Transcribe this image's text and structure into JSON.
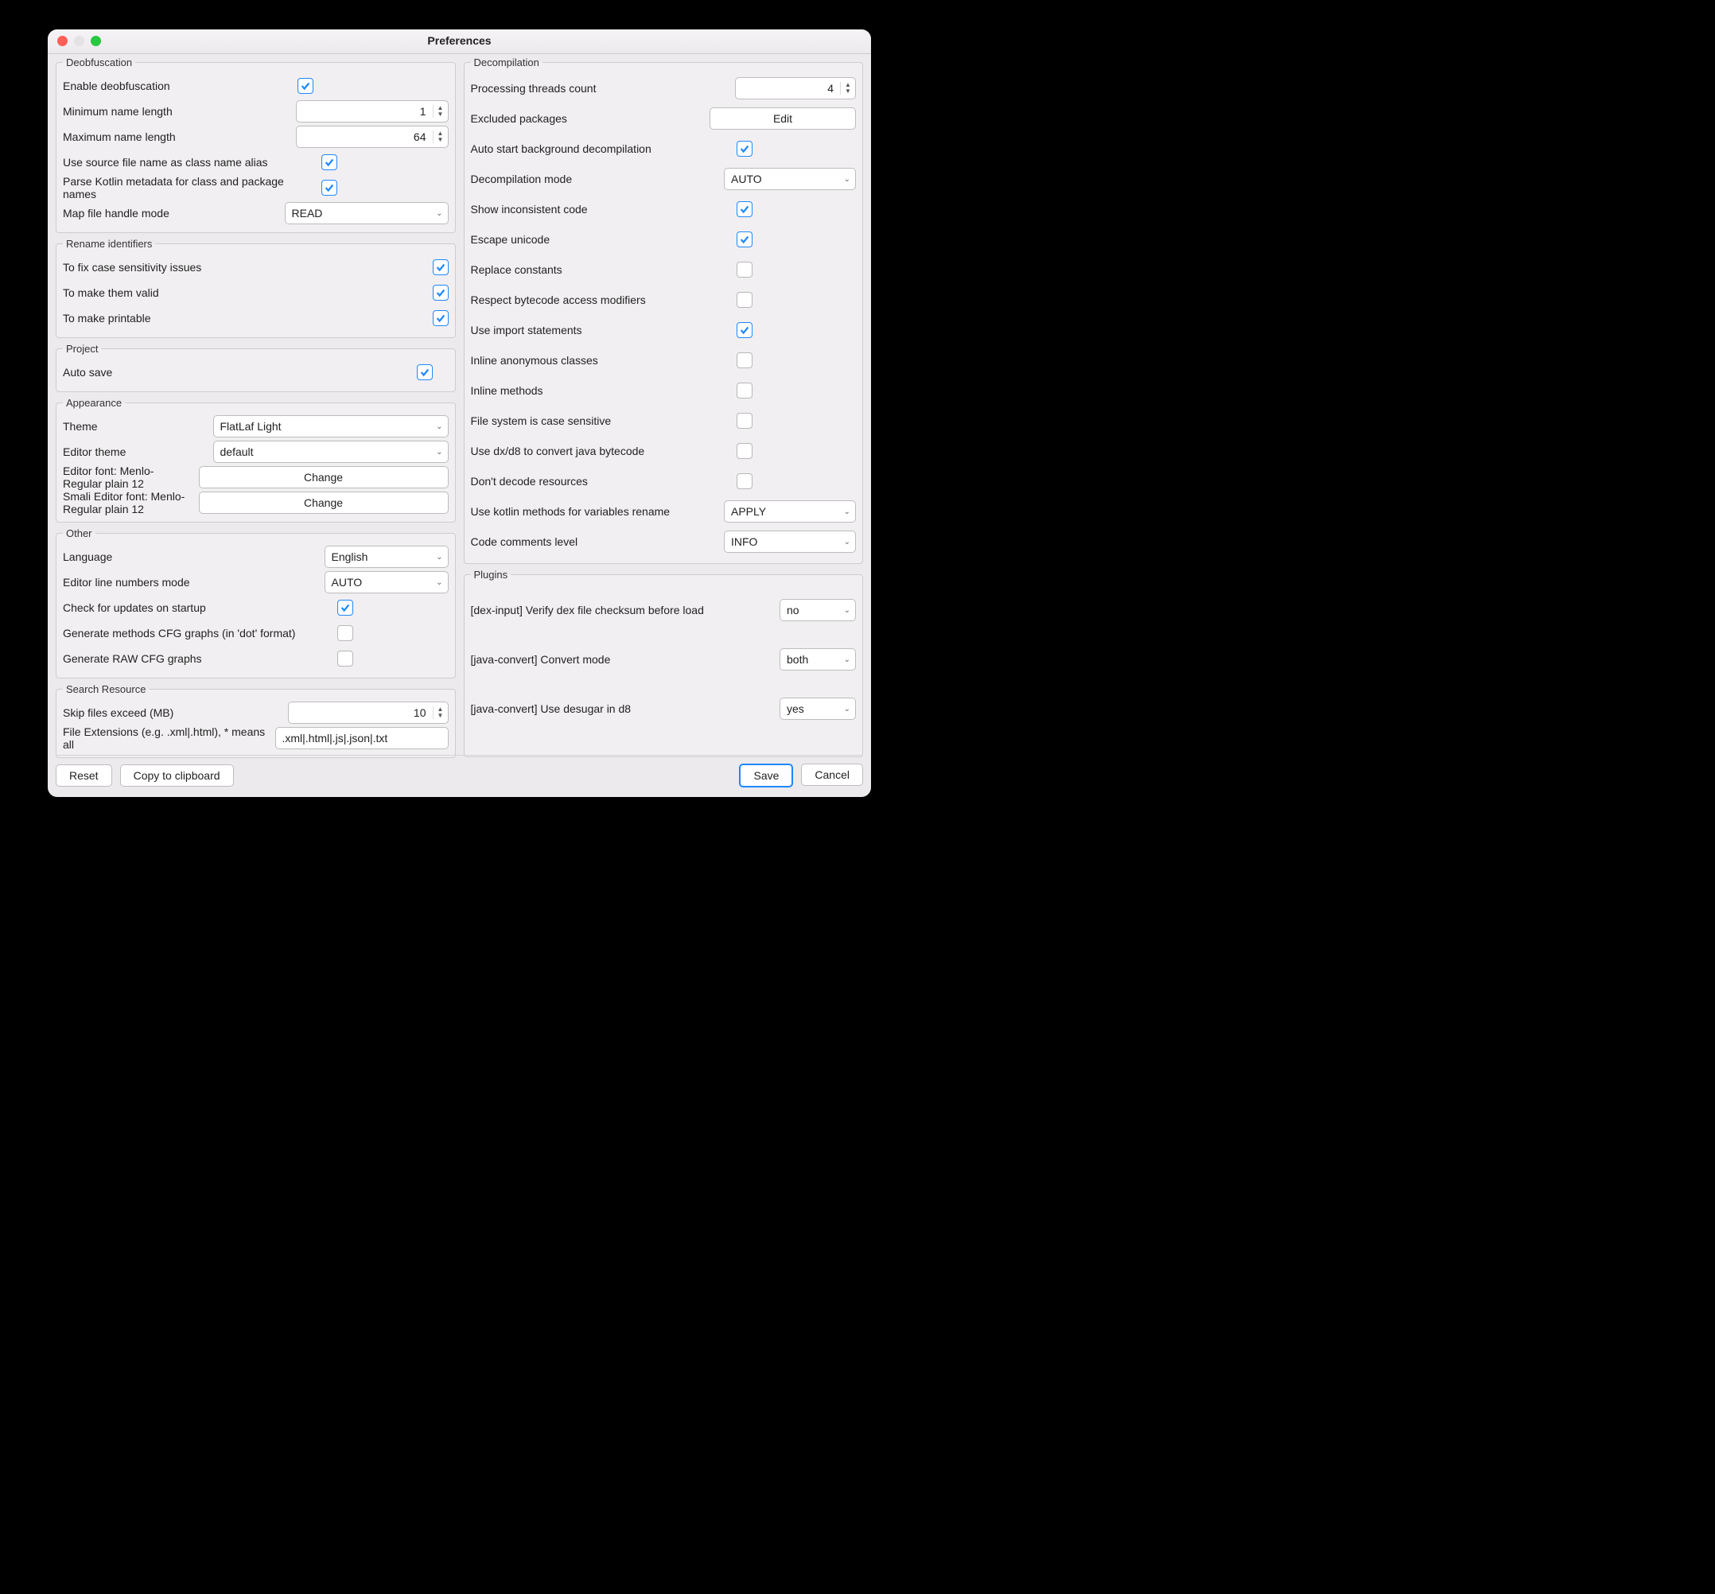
{
  "window_title": "Preferences",
  "left": {
    "deob": {
      "legend": "Deobfuscation",
      "enable_label": "Enable deobfuscation",
      "enable_checked": true,
      "min_len_label": "Minimum name length",
      "min_len_value": "1",
      "max_len_label": "Maximum name length",
      "max_len_value": "64",
      "source_alias_label": "Use source file name as class name alias",
      "source_alias_checked": true,
      "kotlin_meta_label": "Parse Kotlin metadata for class and package names",
      "kotlin_meta_checked": true,
      "map_mode_label": "Map file handle mode",
      "map_mode_value": "READ"
    },
    "rename": {
      "legend": "Rename identifiers",
      "case_label": "To fix case sensitivity issues",
      "case_checked": true,
      "valid_label": "To make them valid",
      "valid_checked": true,
      "printable_label": "To make printable",
      "printable_checked": true
    },
    "project": {
      "legend": "Project",
      "autosave_label": "Auto save",
      "autosave_checked": true
    },
    "appearance": {
      "legend": "Appearance",
      "theme_label": "Theme",
      "theme_value": "FlatLaf Light",
      "editor_theme_label": "Editor theme",
      "editor_theme_value": "default",
      "editor_font_label": "Editor font: Menlo-Regular plain 12",
      "editor_font_btn": "Change",
      "smali_font_label": "Smali Editor font: Menlo-Regular plain 12",
      "smali_font_btn": "Change"
    },
    "other": {
      "legend": "Other",
      "language_label": "Language",
      "language_value": "English",
      "line_numbers_label": "Editor line numbers mode",
      "line_numbers_value": "AUTO",
      "check_updates_label": "Check for updates on startup",
      "check_updates_checked": true,
      "cfg_dot_label": "Generate methods CFG graphs (in 'dot' format)",
      "cfg_dot_checked": false,
      "cfg_raw_label": "Generate RAW CFG graphs",
      "cfg_raw_checked": false
    },
    "search": {
      "legend": "Search Resource",
      "skip_label": "Skip files exceed (MB)",
      "skip_value": "10",
      "ext_label": "File Extensions (e.g. .xml|.html), * means all",
      "ext_value": ".xml|.html|.js|.json|.txt"
    }
  },
  "right": {
    "decomp": {
      "legend": "Decompilation",
      "threads_label": "Processing threads count",
      "threads_value": "4",
      "excluded_label": "Excluded packages",
      "excluded_btn": "Edit",
      "autostart_label": "Auto start background decompilation",
      "autostart_checked": true,
      "mode_label": "Decompilation mode",
      "mode_value": "AUTO",
      "inconsistent_label": "Show inconsistent code",
      "inconsistent_checked": true,
      "escape_label": "Escape unicode",
      "escape_checked": true,
      "replace_const_label": "Replace constants",
      "replace_const_checked": false,
      "respect_access_label": "Respect bytecode access modifiers",
      "respect_access_checked": false,
      "imports_label": "Use import statements",
      "imports_checked": true,
      "inline_anon_label": "Inline anonymous classes",
      "inline_anon_checked": false,
      "inline_methods_label": "Inline methods",
      "inline_methods_checked": false,
      "fs_case_label": "File system is case sensitive",
      "fs_case_checked": false,
      "dx_label": "Use dx/d8 to convert java bytecode",
      "dx_checked": false,
      "dont_decode_label": "Don't decode resources",
      "dont_decode_checked": false,
      "kotlin_rename_label": "Use kotlin methods for variables rename",
      "kotlin_rename_value": "APPLY",
      "comments_label": "Code comments level",
      "comments_value": "INFO"
    },
    "plugins": {
      "legend": "Plugins",
      "dex_label": "[dex-input]  Verify dex file checksum before load",
      "dex_value": "no",
      "jc_mode_label": "[java-convert]  Convert mode",
      "jc_mode_value": "both",
      "jc_d8_label": "[java-convert]  Use desugar in d8",
      "jc_d8_value": "yes"
    }
  },
  "footer": {
    "reset": "Reset",
    "copy": "Copy to clipboard",
    "save": "Save",
    "cancel": "Cancel"
  }
}
